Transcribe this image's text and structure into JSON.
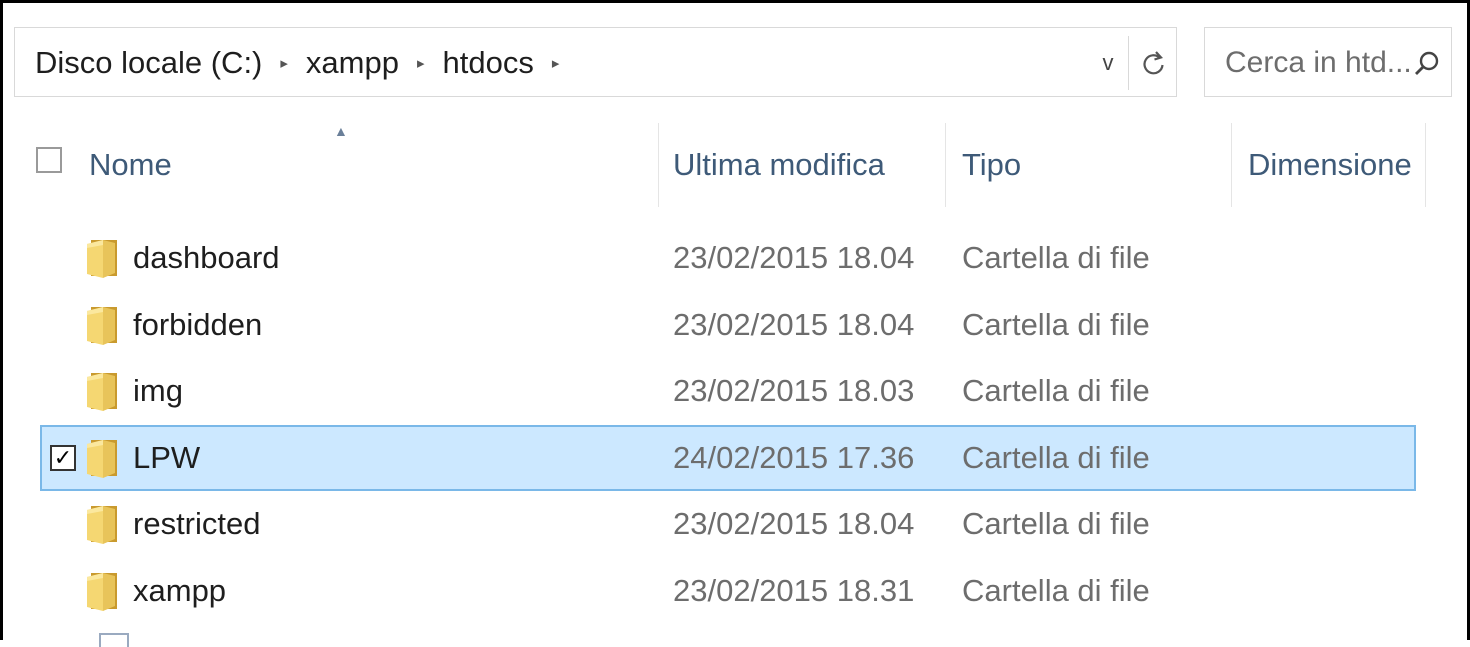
{
  "address_bar": {
    "crumbs": [
      "Disco locale (C:)",
      "xampp",
      "htdocs"
    ],
    "separator": "▸",
    "dropdown_glyph": "v"
  },
  "search": {
    "placeholder": "Cerca in htd..."
  },
  "columns": {
    "name": "Nome",
    "modified": "Ultima modifica",
    "type": "Tipo",
    "size": "Dimensione",
    "sort_glyph": "▲"
  },
  "rows": [
    {
      "name": "dashboard",
      "modified": "23/02/2015 18.04",
      "type": "Cartella di file",
      "selected": false
    },
    {
      "name": "forbidden",
      "modified": "23/02/2015 18.04",
      "type": "Cartella di file",
      "selected": false
    },
    {
      "name": "img",
      "modified": "23/02/2015 18.03",
      "type": "Cartella di file",
      "selected": false
    },
    {
      "name": "LPW",
      "modified": "24/02/2015 17.36",
      "type": "Cartella di file",
      "selected": true
    },
    {
      "name": "restricted",
      "modified": "23/02/2015 18.04",
      "type": "Cartella di file",
      "selected": false
    },
    {
      "name": "xampp",
      "modified": "23/02/2015 18.31",
      "type": "Cartella di file",
      "selected": false
    }
  ],
  "check_glyph": "✓",
  "colors": {
    "selection_bg": "#cce8ff",
    "selection_border": "#7ab8e8",
    "header_text": "#3e5a78",
    "folder_yellow": "#e8c45a"
  }
}
